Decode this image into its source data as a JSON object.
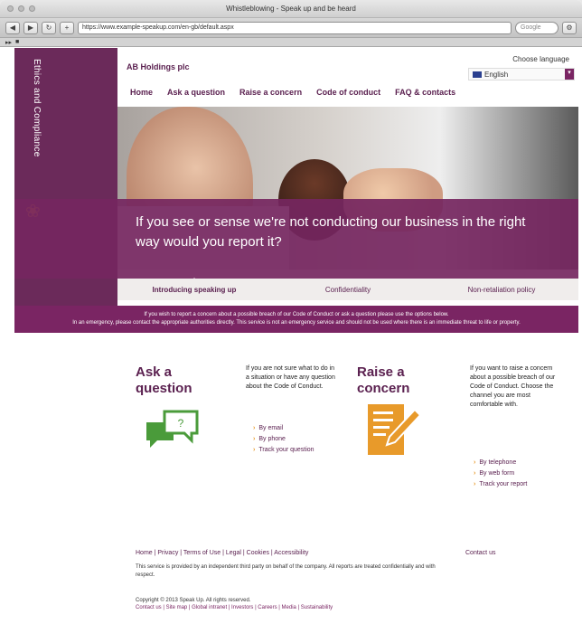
{
  "browser": {
    "window_title": "Whistleblowing - Speak up and be heard",
    "url": "https://www.example-speakup.com/en-gb/default.aspx",
    "search_placeholder": "Google",
    "bookmarks": [
      "▸▸",
      "■"
    ]
  },
  "brand": {
    "vertical_text": "Ethics and Compliance",
    "logo": "AB Holdings plc"
  },
  "header": {
    "choose_language": "Choose language",
    "language_value": "English",
    "nav": [
      "Home",
      "Ask a question",
      "Raise a concern",
      "Code of conduct",
      "FAQ & contacts"
    ]
  },
  "hero": {
    "question": "If you see or sense we're not conducting our business in the right way would you report it?"
  },
  "tabs": [
    "Introducing speaking up",
    "Confidentiality",
    "Non-retaliation policy"
  ],
  "notice": {
    "line1": "If you wish to report a concern about a possible breach of our Code of Conduct or ask a question please use the options below.",
    "line2": "In an emergency, please contact the appropriate authorities directly. This service is not an emergency service and should not be used where there is an immediate threat to life or property."
  },
  "ask": {
    "heading_line1": "Ask a",
    "heading_line2": "question",
    "description": "If you are not sure what to do in a situation or have any question about the Code of Conduct.",
    "links": [
      "By email",
      "By phone",
      "Track your question"
    ]
  },
  "raise": {
    "heading_line1": "Raise a",
    "heading_line2": "concern",
    "description": "If you want to raise a concern about a possible breach of our Code of Conduct. Choose the channel you are most comfortable with.",
    "links": [
      "By telephone",
      "By web form",
      "Track your report"
    ]
  },
  "footer": {
    "links_line": "Home | Privacy | Terms of Use | Legal | Cookies | Accessibility",
    "right_link": "Contact us",
    "description": "This service is provided by an independent third party on behalf of the company. All reports are treated confidentially and with respect.",
    "copyright": "Copyright © 2013 Speak Up. All rights reserved.",
    "bottom_links": "Contact us | Site map | Global intranet | Investors | Careers | Media | Sustainability"
  },
  "colors": {
    "brand_purple": "#7a2563",
    "accent_orange": "#e89a2a",
    "accent_green": "#4a9b3a"
  }
}
